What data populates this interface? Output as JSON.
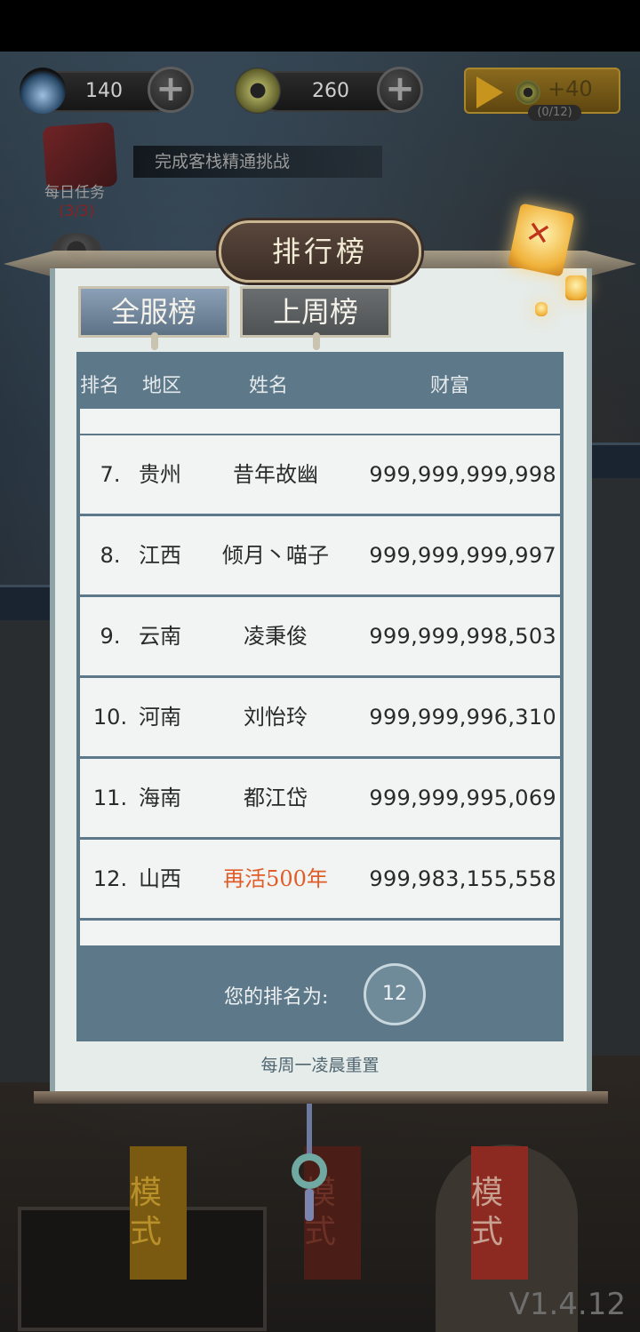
{
  "topbar": {
    "spirit": {
      "value": "140",
      "icon": "flame-icon"
    },
    "coins": {
      "value": "260",
      "icon": "coin-icon"
    },
    "video_reward": {
      "label": "+40",
      "progress": "(0/12)"
    }
  },
  "task": {
    "label": "每日任务",
    "count": "(3/3)",
    "message": "完成客栈精通挑战"
  },
  "leaderboard": {
    "title": "排行榜",
    "tabs": [
      "全服榜",
      "上周榜"
    ],
    "columns": [
      "排名",
      "地区",
      "姓名",
      "财富"
    ],
    "rows": [
      {
        "rank": "7.",
        "region": "贵州",
        "name": "昔年故幽",
        "wealth": "999,999,999,998"
      },
      {
        "rank": "8.",
        "region": "江西",
        "name": "倾月丶喵子",
        "wealth": "999,999,999,997"
      },
      {
        "rank": "9.",
        "region": "云南",
        "name": "凌秉俊",
        "wealth": "999,999,998,503"
      },
      {
        "rank": "10.",
        "region": "河南",
        "name": "刘怡玲",
        "wealth": "999,999,996,310"
      },
      {
        "rank": "11.",
        "region": "海南",
        "name": "都江岱",
        "wealth": "999,999,995,069"
      },
      {
        "rank": "12.",
        "region": "山西",
        "name": "再活500年",
        "wealth": "999,983,155,558"
      }
    ],
    "my_rank_label": "您的排名为:",
    "my_rank": "12",
    "reset_note": "每周一凌晨重置"
  },
  "background_banners": [
    "模式",
    "模式",
    "模式"
  ],
  "version": "V1.4.12",
  "colors": {
    "highlight_name": "#e05d28",
    "table_header": "#5d7888",
    "active_tab": "#8ba0b6"
  }
}
